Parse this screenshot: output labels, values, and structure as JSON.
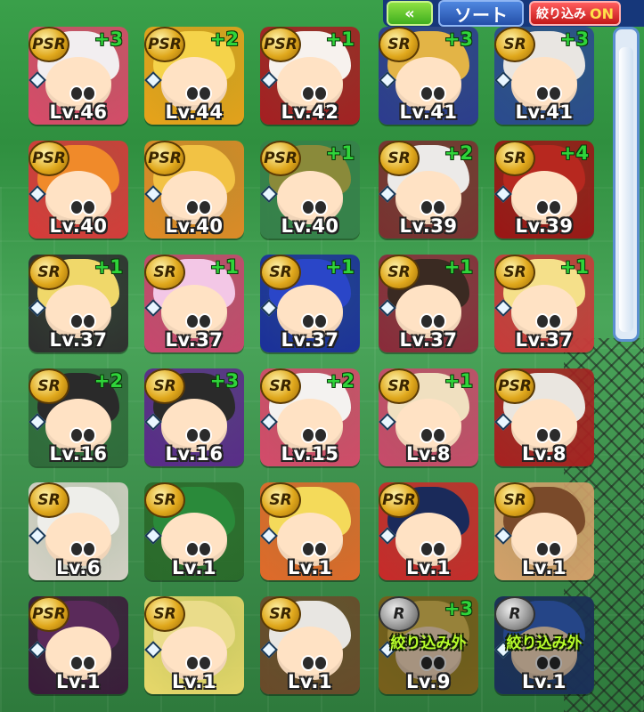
{
  "toolbar": {
    "back_icon": "double-chevron-left-icon",
    "sort_label": "ソート",
    "filter_label": "絞り込み",
    "filter_state": "ON"
  },
  "cards": [
    {
      "rarity": "PSR",
      "plus": "+3",
      "level": "Lv.46",
      "color": "#d94a6a",
      "hair": "#f2eef0"
    },
    {
      "rarity": "PSR",
      "plus": "+2",
      "level": "Lv.44",
      "color": "#e8a21a",
      "hair": "#f5d34a"
    },
    {
      "rarity": "PSR",
      "plus": "+1",
      "level": "Lv.42",
      "color": "#a61e22",
      "hair": "#f7f2ee"
    },
    {
      "rarity": "SR",
      "plus": "+3",
      "level": "Lv.41",
      "color": "#2d3b8f",
      "hair": "#e3b446"
    },
    {
      "rarity": "SR",
      "plus": "+3",
      "level": "Lv.41",
      "color": "#2b4a8f",
      "hair": "#e9e6e2"
    },
    {
      "rarity": "PSR",
      "plus": "",
      "level": "Lv.40",
      "color": "#d73a3a",
      "hair": "#f08a2a"
    },
    {
      "rarity": "PSR",
      "plus": "",
      "level": "Lv.40",
      "color": "#e08a26",
      "hair": "#f2c244"
    },
    {
      "rarity": "PSR",
      "plus": "+1",
      "level": "Lv.40",
      "color": "#36804a",
      "hair": "#8a8a3a"
    },
    {
      "rarity": "SR",
      "plus": "+2",
      "level": "Lv.39",
      "color": "#7a3030",
      "hair": "#eceae8"
    },
    {
      "rarity": "SR",
      "plus": "+4",
      "level": "Lv.39",
      "color": "#9b1515",
      "hair": "#b7281f"
    },
    {
      "rarity": "SR",
      "plus": "+1",
      "level": "Lv.37",
      "color": "#2e2e2e",
      "hair": "#f0d86a"
    },
    {
      "rarity": "SR",
      "plus": "+1",
      "level": "Lv.37",
      "color": "#c8466e",
      "hair": "#f3c7e6"
    },
    {
      "rarity": "SR",
      "plus": "+1",
      "level": "Lv.37",
      "color": "#1b2f9a",
      "hair": "#2a46c8"
    },
    {
      "rarity": "SR",
      "plus": "+1",
      "level": "Lv.37",
      "color": "#8a2a3a",
      "hair": "#3a2a22"
    },
    {
      "rarity": "SR",
      "plus": "+1",
      "level": "Lv.37",
      "color": "#c83a3a",
      "hair": "#f5e08a"
    },
    {
      "rarity": "SR",
      "plus": "+2",
      "level": "Lv.16",
      "color": "#2f6a3a",
      "hair": "#2a2a2a"
    },
    {
      "rarity": "SR",
      "plus": "+3",
      "level": "Lv.16",
      "color": "#5a2a8a",
      "hair": "#2a2a2a"
    },
    {
      "rarity": "SR",
      "plus": "+2",
      "level": "Lv.15",
      "color": "#d44a6a",
      "hair": "#f4f2f0"
    },
    {
      "rarity": "SR",
      "plus": "+1",
      "level": "Lv.8",
      "color": "#c84a6a",
      "hair": "#f0e0c0"
    },
    {
      "rarity": "PSR",
      "plus": "",
      "level": "Lv.8",
      "color": "#a82020",
      "hair": "#eae6e0"
    },
    {
      "rarity": "SR",
      "plus": "",
      "level": "Lv.6",
      "color": "#d7d2c8",
      "hair": "#eeeeea"
    },
    {
      "rarity": "SR",
      "plus": "",
      "level": "Lv.1",
      "color": "#2a6a2a",
      "hair": "#2a8a3a"
    },
    {
      "rarity": "SR",
      "plus": "",
      "level": "Lv.1",
      "color": "#e06a2a",
      "hair": "#f4da5a"
    },
    {
      "rarity": "PSR",
      "plus": "",
      "level": "Lv.1",
      "color": "#c82a2a",
      "hair": "#1a2a5a"
    },
    {
      "rarity": "SR",
      "plus": "",
      "level": "Lv.1",
      "color": "#d4a06a",
      "hair": "#7a4a2a"
    },
    {
      "rarity": "PSR",
      "plus": "",
      "level": "Lv.1",
      "color": "#3a1a3a",
      "hair": "#5a2a5a"
    },
    {
      "rarity": "SR",
      "plus": "",
      "level": "Lv.1",
      "color": "#e8d86a",
      "hair": "#eadc8a"
    },
    {
      "rarity": "SR",
      "plus": "",
      "level": "Lv.1",
      "color": "#6a4a2a",
      "hair": "#e8e6e2"
    },
    {
      "rarity": "R",
      "plus": "+3",
      "level": "Lv.9",
      "color": "#b8932a",
      "hair": "#e8c85a",
      "excluded": "絞り込み外"
    },
    {
      "rarity": "R",
      "plus": "",
      "level": "Lv.1",
      "color": "#2a4a8a",
      "hair": "#3a6ad0",
      "excluded": "絞り込み外"
    }
  ]
}
